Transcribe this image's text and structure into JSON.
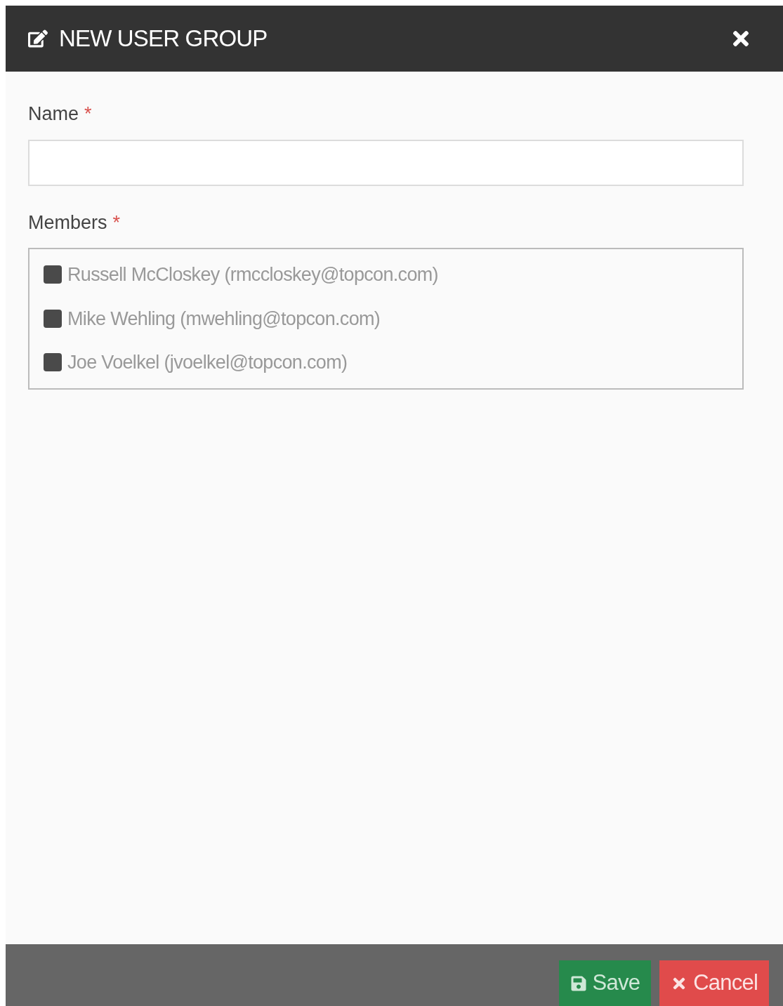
{
  "dialog": {
    "title": "NEW USER GROUP"
  },
  "fields": [
    {
      "label": "Name",
      "required_mark": "*"
    }
  ],
  "members": {
    "label": "Members",
    "required_mark": "*",
    "options": [
      {
        "label": "Russell McCloskey (rmccloskey@topcon.com)",
        "checked": false
      },
      {
        "label": "Mike Wehling (mwehling@topcon.com)",
        "checked": false
      },
      {
        "label": "Joe Voelkel (jvoelkel@topcon.com)",
        "checked": false
      }
    ]
  },
  "buttons": [
    {
      "kind": "save",
      "label": "Save"
    },
    {
      "kind": "cancel",
      "label": "Cancel"
    }
  ]
}
